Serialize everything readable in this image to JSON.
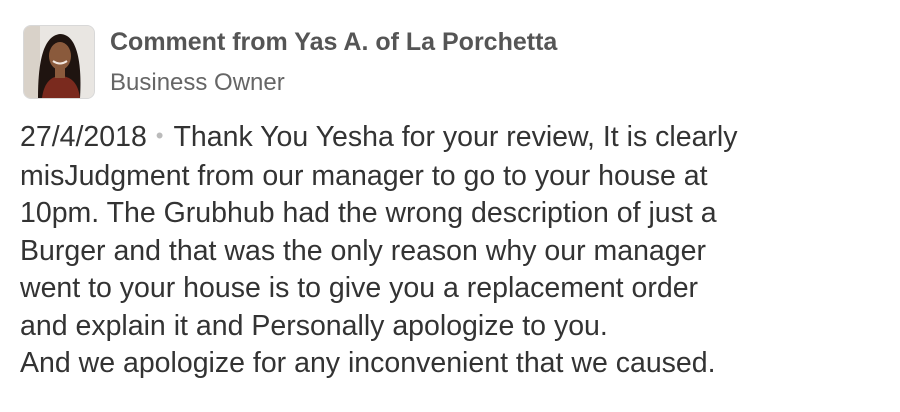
{
  "comment": {
    "author_line": "Comment from Yas A. of La Porchetta",
    "role": "Business Owner",
    "avatar_icon": "person-avatar",
    "date": "27/4/2018",
    "separator": "•",
    "lines": [
      "Thank You Yesha for your review, It is clearly",
      "misJudgment  from our manager to go to your house at",
      "10pm. The Grubhub had the wrong description of just a",
      "Burger and that was the only reason why our manager",
      "went to your house is to give you a replacement order",
      "and explain it and Personally apologize to you.",
      "And we apologize for any inconvenient that we caused."
    ]
  }
}
